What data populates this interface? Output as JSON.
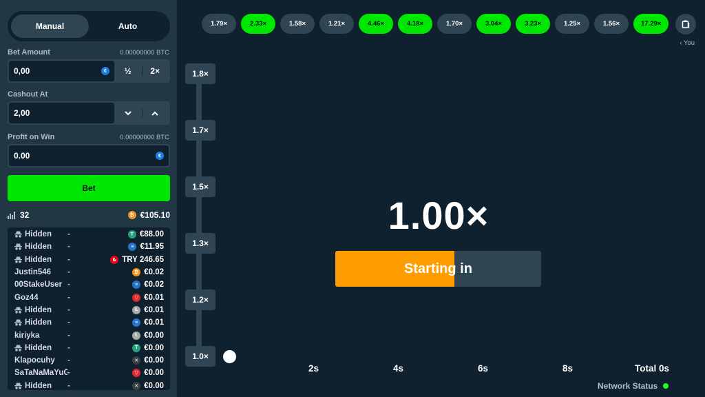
{
  "controls": {
    "modes": [
      "Manual",
      "Auto"
    ],
    "active_mode": "Manual",
    "bet_amount": {
      "label": "Bet Amount",
      "btc": "0.00000000 BTC",
      "value": "0,00",
      "half": "½",
      "double": "2×"
    },
    "cashout": {
      "label": "Cashout At",
      "value": "2,00"
    },
    "profit": {
      "label": "Profit on Win",
      "btc": "0.00000000 BTC",
      "value": "0.00"
    },
    "bet_button": "Bet"
  },
  "stats": {
    "players": "32",
    "total": "€105.10"
  },
  "players": [
    {
      "name": "Hidden",
      "hidden": true,
      "mult": "-",
      "coin": "usdt",
      "amount": "€88.00"
    },
    {
      "name": "Hidden",
      "hidden": true,
      "mult": "-",
      "coin": "usdc",
      "amount": "€11.95"
    },
    {
      "name": "Hidden",
      "hidden": true,
      "mult": "-",
      "coin": "try",
      "amount": "TRY 246.65"
    },
    {
      "name": "Justin546",
      "hidden": false,
      "mult": "-",
      "coin": "btc",
      "amount": "€0.02"
    },
    {
      "name": "00StakeUser",
      "hidden": false,
      "mult": "-",
      "coin": "usdc",
      "amount": "€0.02"
    },
    {
      "name": "Goz44",
      "hidden": false,
      "mult": "-",
      "coin": "trx",
      "amount": "€0.01"
    },
    {
      "name": "Hidden",
      "hidden": true,
      "mult": "-",
      "coin": "ltc",
      "amount": "€0.01"
    },
    {
      "name": "Hidden",
      "hidden": true,
      "mult": "-",
      "coin": "usdc",
      "amount": "€0.01"
    },
    {
      "name": "kiriyka",
      "hidden": false,
      "mult": "-",
      "coin": "ltc",
      "amount": "€0.00"
    },
    {
      "name": "Hidden",
      "hidden": true,
      "mult": "-",
      "coin": "usdt",
      "amount": "€0.00"
    },
    {
      "name": "Klapocuhy",
      "hidden": false,
      "mult": "-",
      "coin": "xrp",
      "amount": "€0.00"
    },
    {
      "name": "SaTaNaMaYuG",
      "hidden": false,
      "mult": "-",
      "coin": "trx",
      "amount": "€0.00"
    },
    {
      "name": "Hidden",
      "hidden": true,
      "mult": "-",
      "coin": "xrp",
      "amount": "€0.00"
    }
  ],
  "history": [
    {
      "value": "1.79×",
      "win": false
    },
    {
      "value": "2.33×",
      "win": true
    },
    {
      "value": "1.58×",
      "win": false
    },
    {
      "value": "1.21×",
      "win": false
    },
    {
      "value": "4.46×",
      "win": true
    },
    {
      "value": "4.18×",
      "win": true
    },
    {
      "value": "1.70×",
      "win": false
    },
    {
      "value": "3.04×",
      "win": true
    },
    {
      "value": "3.23×",
      "win": true
    },
    {
      "value": "1.25×",
      "win": false
    },
    {
      "value": "1.56×",
      "win": false
    },
    {
      "value": "17.29×",
      "win": true
    }
  ],
  "you_label": "‹ You",
  "graph": {
    "y_ticks": [
      "1.8×",
      "1.7×",
      "1.5×",
      "1.3×",
      "1.2×",
      "1.0×"
    ],
    "x_ticks": [
      "2s",
      "4s",
      "6s",
      "8s"
    ],
    "total_label": "Total 0s"
  },
  "game": {
    "multiplier": "1.00×",
    "status": "Starting in",
    "progress": 0.58
  },
  "network_status": "Network Status",
  "colors": {
    "accent_green": "#00e701",
    "progress_orange": "#ff9d00",
    "panel": "#213743",
    "bg": "#0f212e"
  }
}
